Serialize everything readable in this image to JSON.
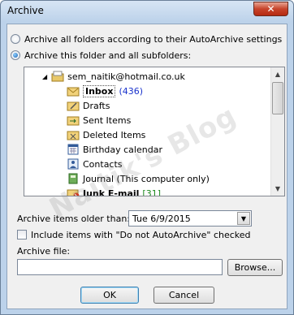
{
  "window": {
    "title": "Archive",
    "close_glyph": "✕"
  },
  "options": {
    "archive_all_label": "Archive all folders according to their AutoArchive settings",
    "archive_this_label": "Archive this folder and all subfolders:"
  },
  "tree": {
    "root": "sem_naitik@hotmail.co.uk",
    "items": [
      {
        "label": "Inbox",
        "count": "(436)",
        "icon": "inbox-folder-icon"
      },
      {
        "label": "Drafts",
        "icon": "drafts-folder-icon"
      },
      {
        "label": "Sent Items",
        "icon": "sent-items-folder-icon"
      },
      {
        "label": "Deleted Items",
        "icon": "deleted-items-folder-icon"
      },
      {
        "label": "Birthday calendar",
        "icon": "calendar-icon"
      },
      {
        "label": "Contacts",
        "icon": "contacts-icon"
      },
      {
        "label": "Journal (This computer only)",
        "icon": "journal-icon"
      },
      {
        "label": "Junk E-mail",
        "count": "[31]",
        "icon": "junk-folder-icon"
      }
    ]
  },
  "archive_older": {
    "label": "Archive items older than:",
    "value": "Tue 6/9/2015"
  },
  "include_checkbox": {
    "label": "Include items with \"Do not AutoArchive\" checked"
  },
  "archive_file": {
    "label": "Archive file:",
    "value": ""
  },
  "buttons": {
    "browse": "Browse...",
    "ok": "OK",
    "cancel": "Cancel"
  },
  "watermark": "Naitik's Blog",
  "colors": {
    "accent": "#1a5fb0",
    "count_blue": "#1a33cc",
    "count_green": "#1f8a1f"
  }
}
